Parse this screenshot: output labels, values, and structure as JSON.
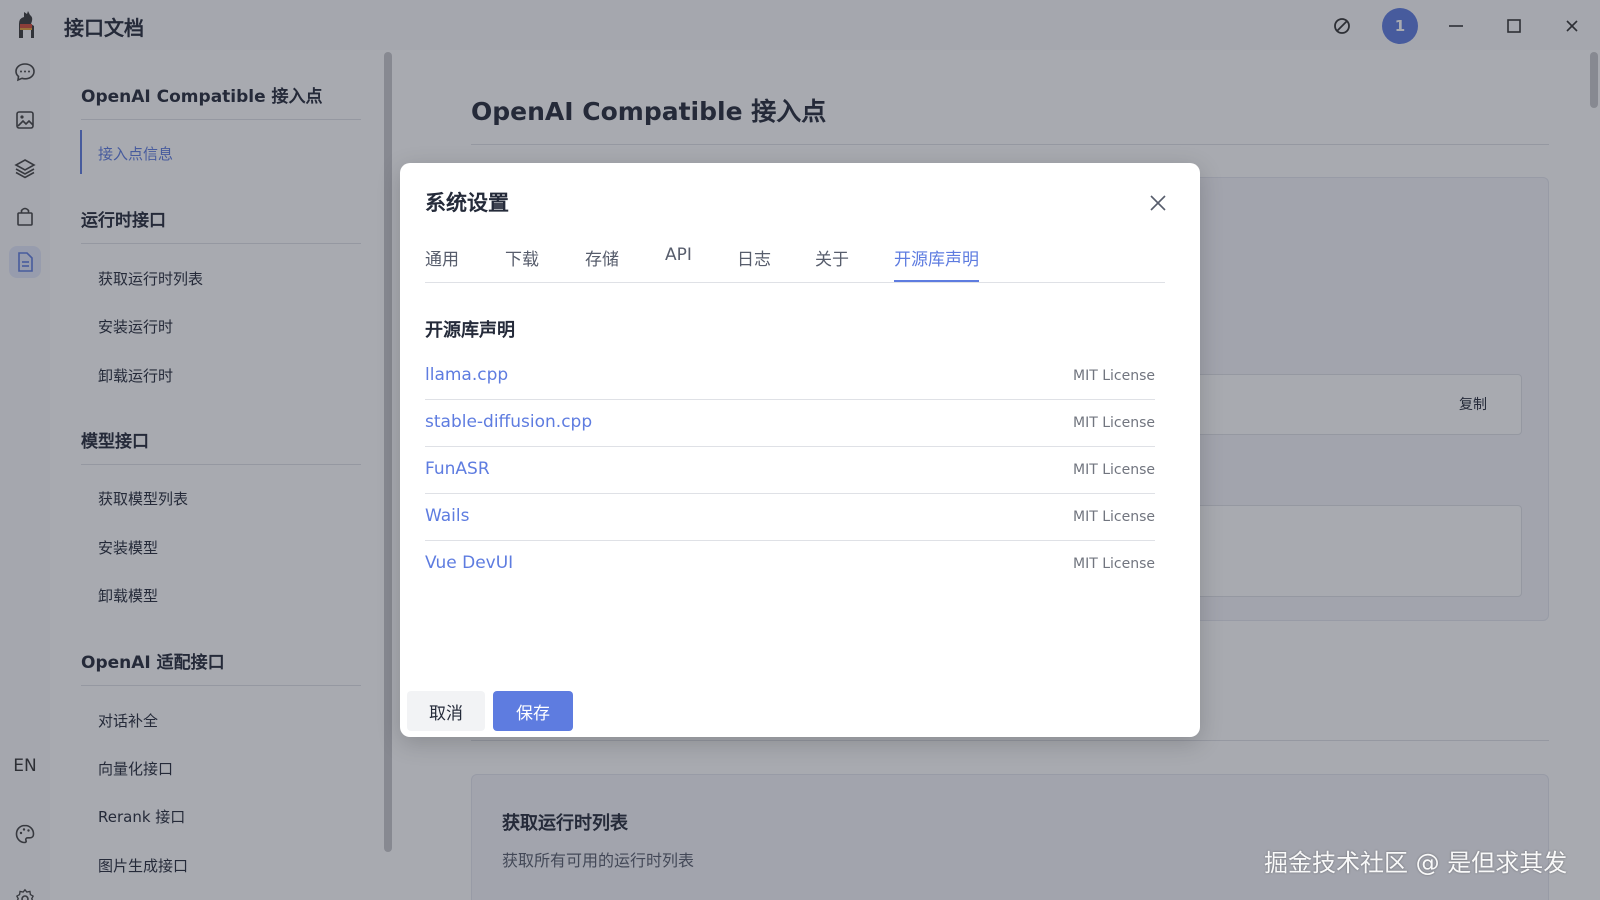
{
  "window": {
    "title": "接口文档",
    "avatar_badge": "1"
  },
  "rail": {
    "lang": "EN"
  },
  "toc": {
    "groups": [
      {
        "title": "OpenAI Compatible 接入点",
        "items": [
          "接入点信息"
        ]
      },
      {
        "title": "运行时接口",
        "items": [
          "获取运行时列表",
          "安装运行时",
          "卸载运行时"
        ]
      },
      {
        "title": "模型接口",
        "items": [
          "获取模型列表",
          "安装模型",
          "卸载模型"
        ]
      },
      {
        "title": "OpenAI 适配接口",
        "items": [
          "对话补全",
          "向量化接口",
          "Rerank 接口",
          "图片生成接口"
        ]
      }
    ]
  },
  "main": {
    "page_title": "OpenAI Compatible 接入点",
    "copy_label": "复制",
    "card2_title": "获取运行时列表",
    "card2_desc": "获取所有可用的运行时列表"
  },
  "dialog": {
    "title": "系统设置",
    "tabs": [
      "通用",
      "下载",
      "存储",
      "API",
      "日志",
      "关于",
      "开源库声明"
    ],
    "active_tab": "开源库声明",
    "section_title": "开源库声明",
    "libraries": [
      {
        "name": "llama.cpp",
        "license": "MIT License"
      },
      {
        "name": "stable-diffusion.cpp",
        "license": "MIT License"
      },
      {
        "name": "FunASR",
        "license": "MIT License"
      },
      {
        "name": "Wails",
        "license": "MIT License"
      },
      {
        "name": "Vue DevUI",
        "license": "MIT License"
      }
    ],
    "cancel_label": "取消",
    "save_label": "保存"
  },
  "watermark": "掘金技术社区 @ 是但求其发",
  "colors": {
    "accent": "#5e7ce0",
    "text": "#252b3a",
    "muted": "#71757f"
  }
}
